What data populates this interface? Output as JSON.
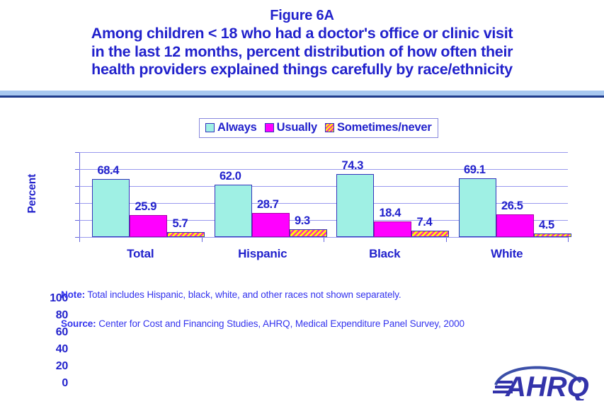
{
  "figure": {
    "label": "Figure 6A",
    "title_lines": [
      "Among children < 18 who had a doctor's office or clinic visit",
      "in the last 12 months, percent distribution of how often their",
      "health providers explained things carefully by race/ethnicity"
    ]
  },
  "legend": {
    "items": [
      {
        "label": "Always",
        "swatch": "square-cyan-icon",
        "color": "#9FF0E4"
      },
      {
        "label": "Usually",
        "swatch": "square-magenta-icon",
        "color": "#FF00FF"
      },
      {
        "label": "Sometimes/never",
        "swatch": "square-striped-yellow-icon",
        "color": "#FFFF00"
      }
    ]
  },
  "notes": {
    "note_lead": "Note:",
    "note_text": " Total includes Hispanic, black, white, and other races not shown separately.",
    "source_lead": "Source:",
    "source_text": " Center for Cost and Financing Studies, AHRQ, Medical Expenditure Panel Survey, 2000"
  },
  "logo": {
    "name": "ahrq-logo",
    "text": "AHRQ",
    "color": "#3333AA"
  },
  "chart_data": {
    "type": "bar",
    "title": "Among children < 18 who had a doctor's office or clinic visit in the last 12 months, percent distribution of how often their health providers explained things carefully by race/ethnicity",
    "xlabel": "",
    "ylabel": "Percent",
    "ylim": [
      0,
      100
    ],
    "yticks": [
      0,
      20,
      40,
      60,
      80,
      100
    ],
    "grid": true,
    "legend_position": "top-center",
    "categories": [
      "Total",
      "Hispanic",
      "Black",
      "White"
    ],
    "series": [
      {
        "name": "Always",
        "color": "#9FF0E4",
        "values": [
          68.4,
          62.0,
          74.3,
          69.1
        ]
      },
      {
        "name": "Usually",
        "color": "#FF00FF",
        "values": [
          25.9,
          28.7,
          18.4,
          26.5
        ]
      },
      {
        "name": "Sometimes/never",
        "color": "#FFFF00",
        "values": [
          5.7,
          9.3,
          7.4,
          4.5
        ]
      }
    ],
    "value_labels": [
      [
        "68.4",
        "25.9",
        "5.7"
      ],
      [
        "62.0",
        "28.7",
        "9.3"
      ],
      [
        "74.3",
        "18.4",
        "7.4"
      ],
      [
        "69.1",
        "26.5",
        "4.5"
      ]
    ]
  }
}
